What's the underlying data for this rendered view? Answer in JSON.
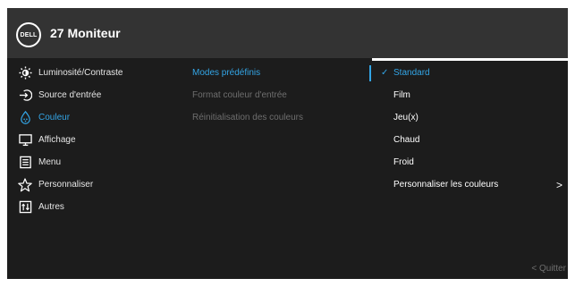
{
  "header": {
    "logo_text": "DELL",
    "title": "27 Moniteur"
  },
  "main_menu": [
    {
      "label": "Luminosité/Contraste",
      "icon": "brightness-icon",
      "active": false
    },
    {
      "label": "Source d'entrée",
      "icon": "input-source-icon",
      "active": false
    },
    {
      "label": "Couleur",
      "icon": "color-icon",
      "active": true
    },
    {
      "label": "Affichage",
      "icon": "display-icon",
      "active": false
    },
    {
      "label": "Menu",
      "icon": "menu-icon",
      "active": false
    },
    {
      "label": "Personnaliser",
      "icon": "star-icon",
      "active": false
    },
    {
      "label": "Autres",
      "icon": "info-icon",
      "active": false
    }
  ],
  "submenu": [
    {
      "label": "Modes prédéfinis",
      "state": "selected"
    },
    {
      "label": "Format couleur d'entrée",
      "state": "disabled"
    },
    {
      "label": "Réinitialisation des couleurs",
      "state": "disabled"
    }
  ],
  "options": [
    {
      "label": "Standard",
      "checked": true
    },
    {
      "label": "Film",
      "checked": false
    },
    {
      "label": "Jeu(x)",
      "checked": false
    },
    {
      "label": "Chaud",
      "checked": false
    },
    {
      "label": "Froid",
      "checked": false
    },
    {
      "label": "Personnaliser les couleurs",
      "checked": false,
      "has_arrow": true,
      "arrow": ">"
    }
  ],
  "check_glyph": "✓",
  "footer": {
    "quit_label": "< Quitter"
  },
  "colors": {
    "accent": "#33a5e6",
    "background": "#1c1c1c",
    "header": "#333333",
    "disabled": "#6e6e6e"
  }
}
